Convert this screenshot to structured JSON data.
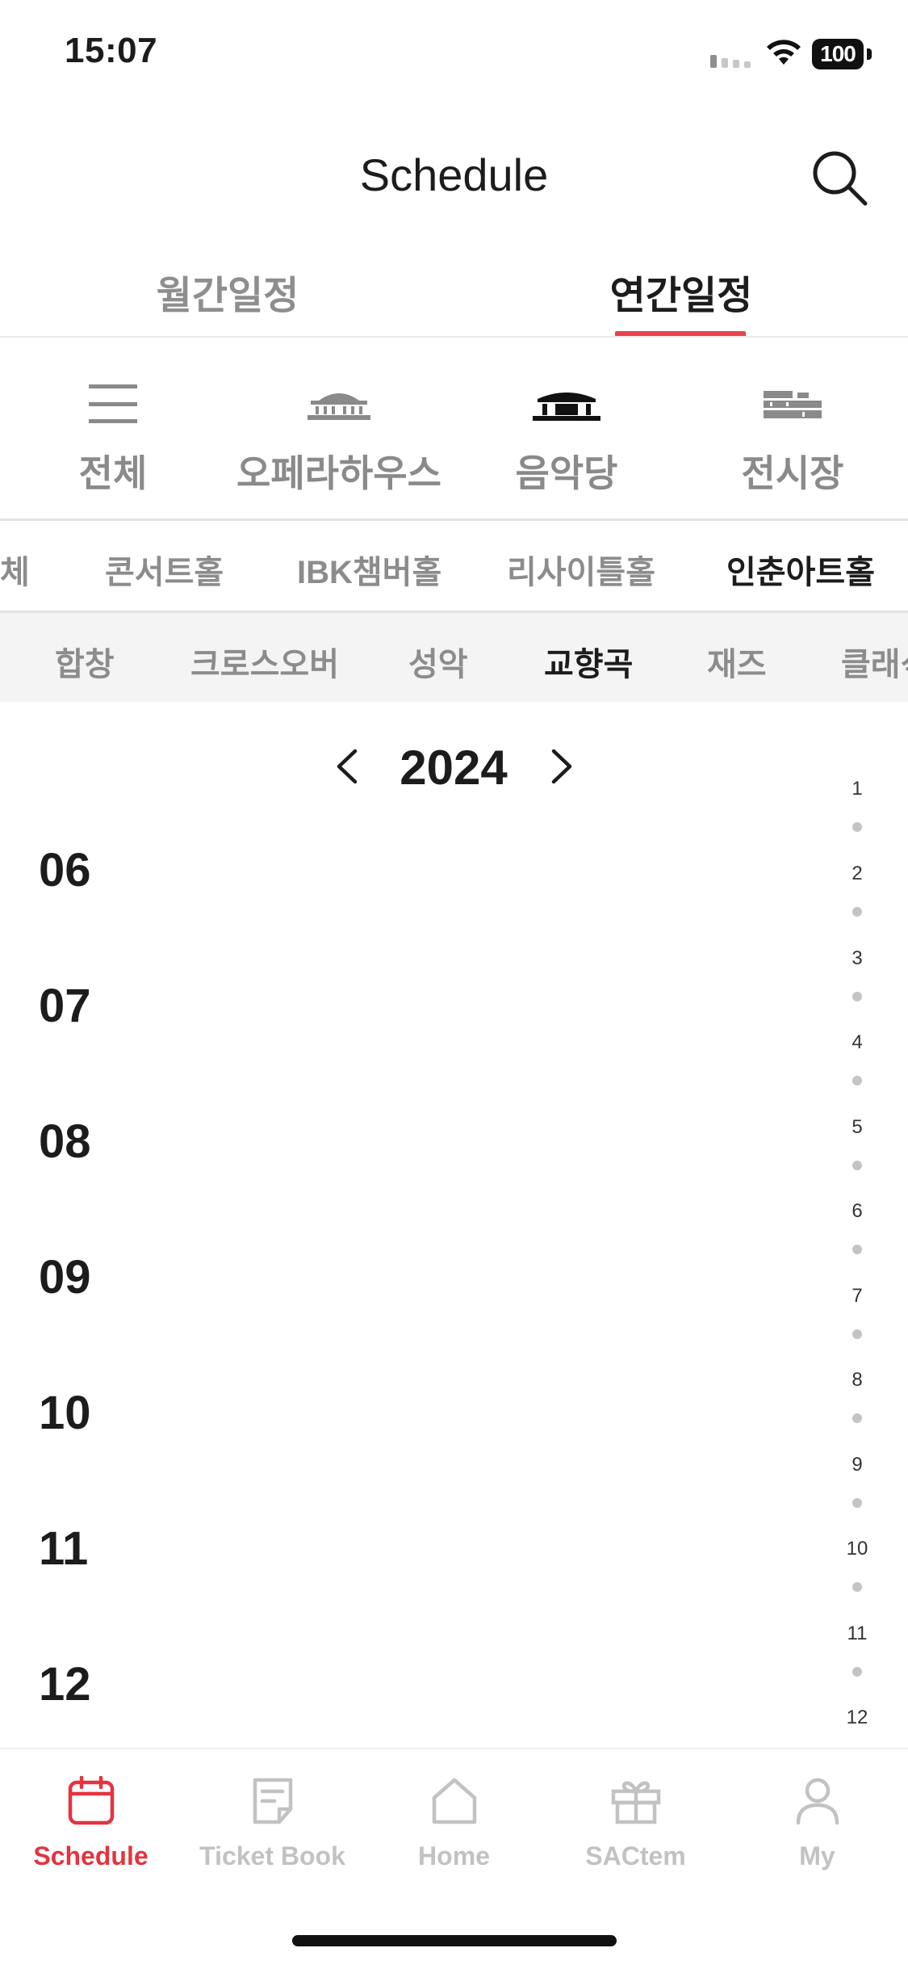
{
  "status_bar": {
    "time": "15:07",
    "battery": "100"
  },
  "header": {
    "title": "Schedule"
  },
  "main_tabs": [
    {
      "label": "월간일정",
      "active": false
    },
    {
      "label": "연간일정",
      "active": true
    }
  ],
  "venues": [
    {
      "label": "전체",
      "icon": "menu-lines-icon",
      "active": false
    },
    {
      "label": "오페라하우스",
      "icon": "opera-house-icon",
      "active": false
    },
    {
      "label": "음악당",
      "icon": "concert-hall-icon",
      "active": true
    },
    {
      "label": "전시장",
      "icon": "exhibition-hall-icon",
      "active": false
    }
  ],
  "halls": [
    {
      "label": "체",
      "active": false
    },
    {
      "label": "콘서트홀",
      "active": false
    },
    {
      "label": "IBK챔버홀",
      "active": false
    },
    {
      "label": "리사이틀홀",
      "active": false
    },
    {
      "label": "인춘아트홀",
      "active": true
    }
  ],
  "genres": [
    {
      "label": "합창",
      "active": false
    },
    {
      "label": "크로스오버",
      "active": false
    },
    {
      "label": "성악",
      "active": false
    },
    {
      "label": "교향곡",
      "active": true
    },
    {
      "label": "재즈",
      "active": false
    },
    {
      "label": "클래식",
      "active": false
    }
  ],
  "year_nav": {
    "year": "2024"
  },
  "months": [
    "06",
    "07",
    "08",
    "09",
    "10",
    "11",
    "12"
  ],
  "month_index": [
    "1",
    "2",
    "3",
    "4",
    "5",
    "6",
    "7",
    "8",
    "9",
    "10",
    "11",
    "12"
  ],
  "tab_bar": [
    {
      "label": "Schedule",
      "icon": "calendar-icon",
      "active": true
    },
    {
      "label": "Ticket Book",
      "icon": "ticket-book-icon",
      "active": false
    },
    {
      "label": "Home",
      "icon": "home-icon",
      "active": false
    },
    {
      "label": "SACtem",
      "icon": "gift-icon",
      "active": false
    },
    {
      "label": "My",
      "icon": "person-icon",
      "active": false
    }
  ],
  "colors": {
    "accent": "#e3343f",
    "underline": "#e8434f"
  }
}
